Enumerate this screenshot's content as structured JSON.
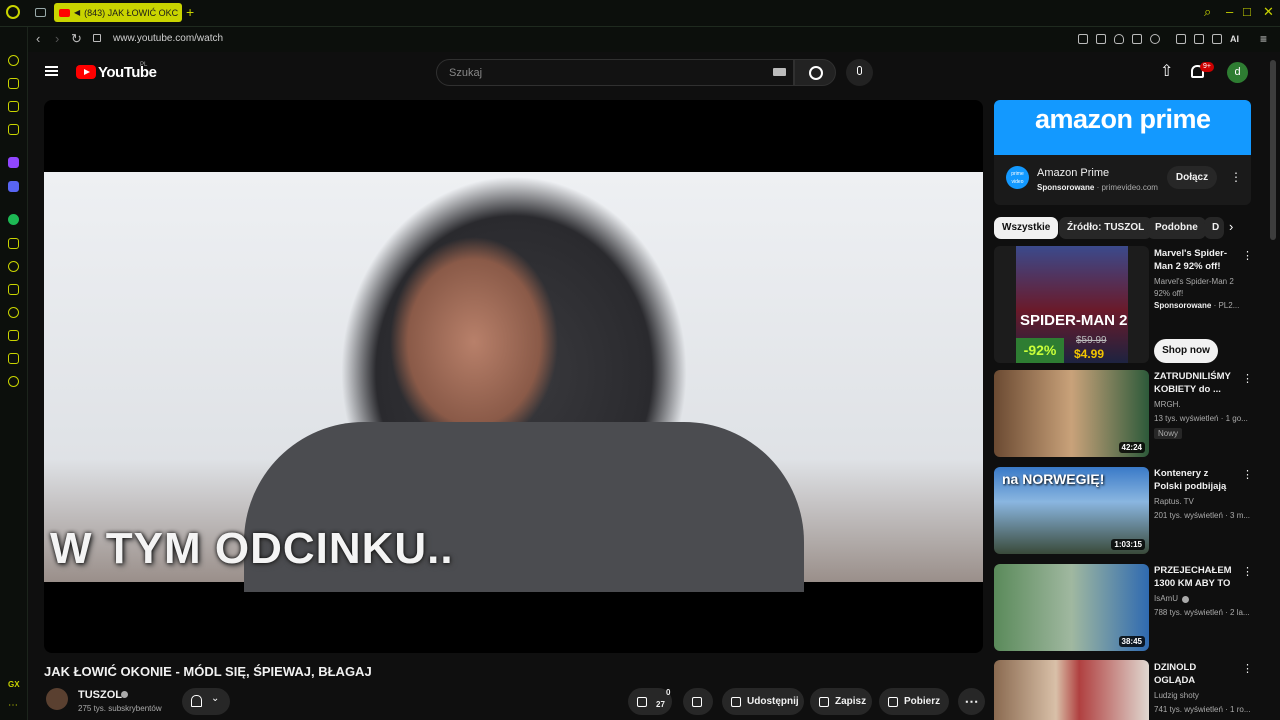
{
  "browser": {
    "tab_title": "(843) JAK ŁOWIĆ OKC",
    "url": "www.youtube.com/watch",
    "ai_label": "AI"
  },
  "youtube": {
    "logo_text": "YouTube",
    "region": "PL",
    "search_placeholder": "Szukaj",
    "notification_count": "9+",
    "avatar_letter": "d"
  },
  "video": {
    "caption_overlay": "W TYM ODCINKU..",
    "title": "JAK ŁOWIĆ OKONIE - MÓDL SIĘ, ŚPIEWAJ, BŁAGAJ",
    "channel": "TUSZOL",
    "subscribers": "275 tys. subskrybentów",
    "likes_top": "0",
    "likes_bottom": "27",
    "share_label": "Udostępnij",
    "save_label": "Zapisz",
    "download_label": "Pobierz",
    "more_label": "⋯"
  },
  "ad": {
    "banner_text": "amazon prime",
    "logo_text": "prime video",
    "title": "Amazon Prime",
    "sponsored": "Sponsorowane",
    "domain": "· primevideo.com",
    "join_label": "Dołącz"
  },
  "chips": [
    "Wszystkie",
    "Źródło: TUSZOL",
    "Podobne",
    "D"
  ],
  "recommendations": [
    {
      "title": "Marvel's Spider-Man 2 92% off!",
      "channel": "Marvel's Spider-Man 2 92% off!",
      "views_sponsored": "Sponsorowane",
      "views_rest": " · PL2...",
      "art_title": "SPIDER-MAN 2",
      "discount": "-92%",
      "old_price": "$59.99",
      "new_price": "$4.99",
      "cta": "Shop now"
    },
    {
      "title": "ZATRUDNILIŚMY KOBIETY do ...",
      "channel": "MRGH.",
      "views": "13 tys. wyświetleń · 1 go...",
      "badge": "Nowy",
      "duration": "42:24"
    },
    {
      "title": "Kontenery z Polski podbijają świat se...",
      "channel": "Raptus. TV",
      "views": "201 tys. wyświetleń · 3 m...",
      "thumb_text": "na NORWEGIĘ!",
      "duration": "1:03:15"
    },
    {
      "title": "PRZEJECHAŁEM 1300 KM ABY TO ...",
      "channel": "IsAmU",
      "views": "788 tys. wyświetleń · 2 la...",
      "duration": "38:45"
    },
    {
      "title": "DZINOLD OGLĄDA BUNGEE - ZEMST...",
      "channel": "Ludzig shoty",
      "views": "741 tys. wyświetleń · 1 ro..."
    }
  ],
  "colors": {
    "opera_accent": "#c9d400",
    "youtube_red": "#ff0000",
    "amazon_blue": "#1399ff",
    "background": "#0f0f0f"
  }
}
